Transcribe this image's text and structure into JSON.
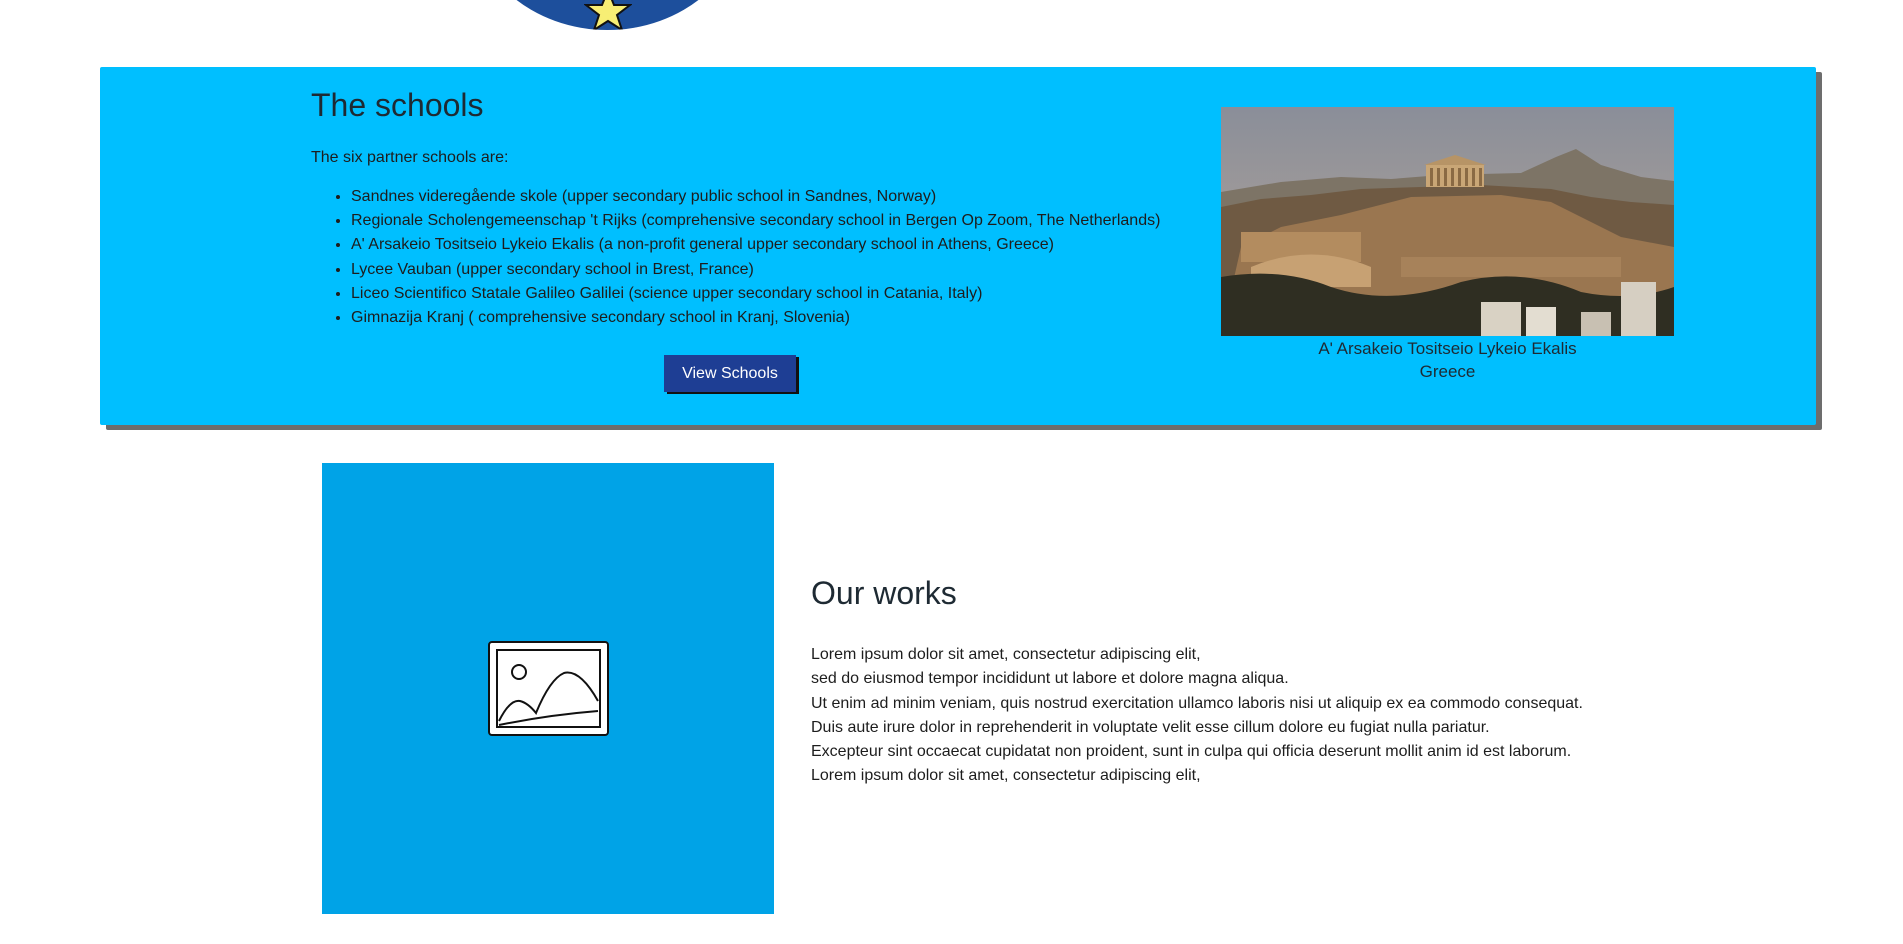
{
  "colors": {
    "panel": "#00bfff",
    "button": "#1e3e94",
    "works_tile": "#00a3e7",
    "emblem": "#1d4f9c"
  },
  "emblem": {
    "icon": "star-icon"
  },
  "schools": {
    "title": "The schools",
    "intro": "The six partner schools are:",
    "items": [
      "Sandnes videregående skole (upper secondary public school in Sandnes, Norway)",
      "Regionale Scholengemeenschap 't Rijks (comprehensive secondary school in Bergen Op Zoom, The Netherlands)",
      "A' Arsakeio Tositseio Lykeio Ekalis (a non-profit general upper secondary school in Athens, Greece)",
      "Lycee Vauban (upper secondary school in Brest, France)",
      "Liceo Scientifico Statale Galileo Galilei (science upper secondary school in Catania, Italy)",
      "Gimnazija Kranj ( comprehensive secondary school in Kranj, Slovenia)"
    ],
    "button_label": "View Schools",
    "photo_alt": "Acropolis of Athens",
    "caption_line1": "A' Arsakeio Tositseio Lykeio Ekalis",
    "caption_line2": "Greece"
  },
  "works": {
    "title": "Our works",
    "image_icon": "image-placeholder-icon",
    "lines": [
      "Lorem ipsum dolor sit amet, consectetur adipiscing elit,",
      "sed do eiusmod tempor incididunt ut labore et dolore magna aliqua.",
      "Ut enim ad minim veniam, quis nostrud exercitation ullamco laboris nisi ut aliquip ex ea commodo consequat.",
      "Duis aute irure dolor in reprehenderit in voluptate velit esse cillum dolore eu fugiat nulla pariatur.",
      "Excepteur sint occaecat cupidatat non proident, sunt in culpa qui officia deserunt mollit anim id est laborum.",
      "Lorem ipsum dolor sit amet, consectetur adipiscing elit,"
    ]
  }
}
